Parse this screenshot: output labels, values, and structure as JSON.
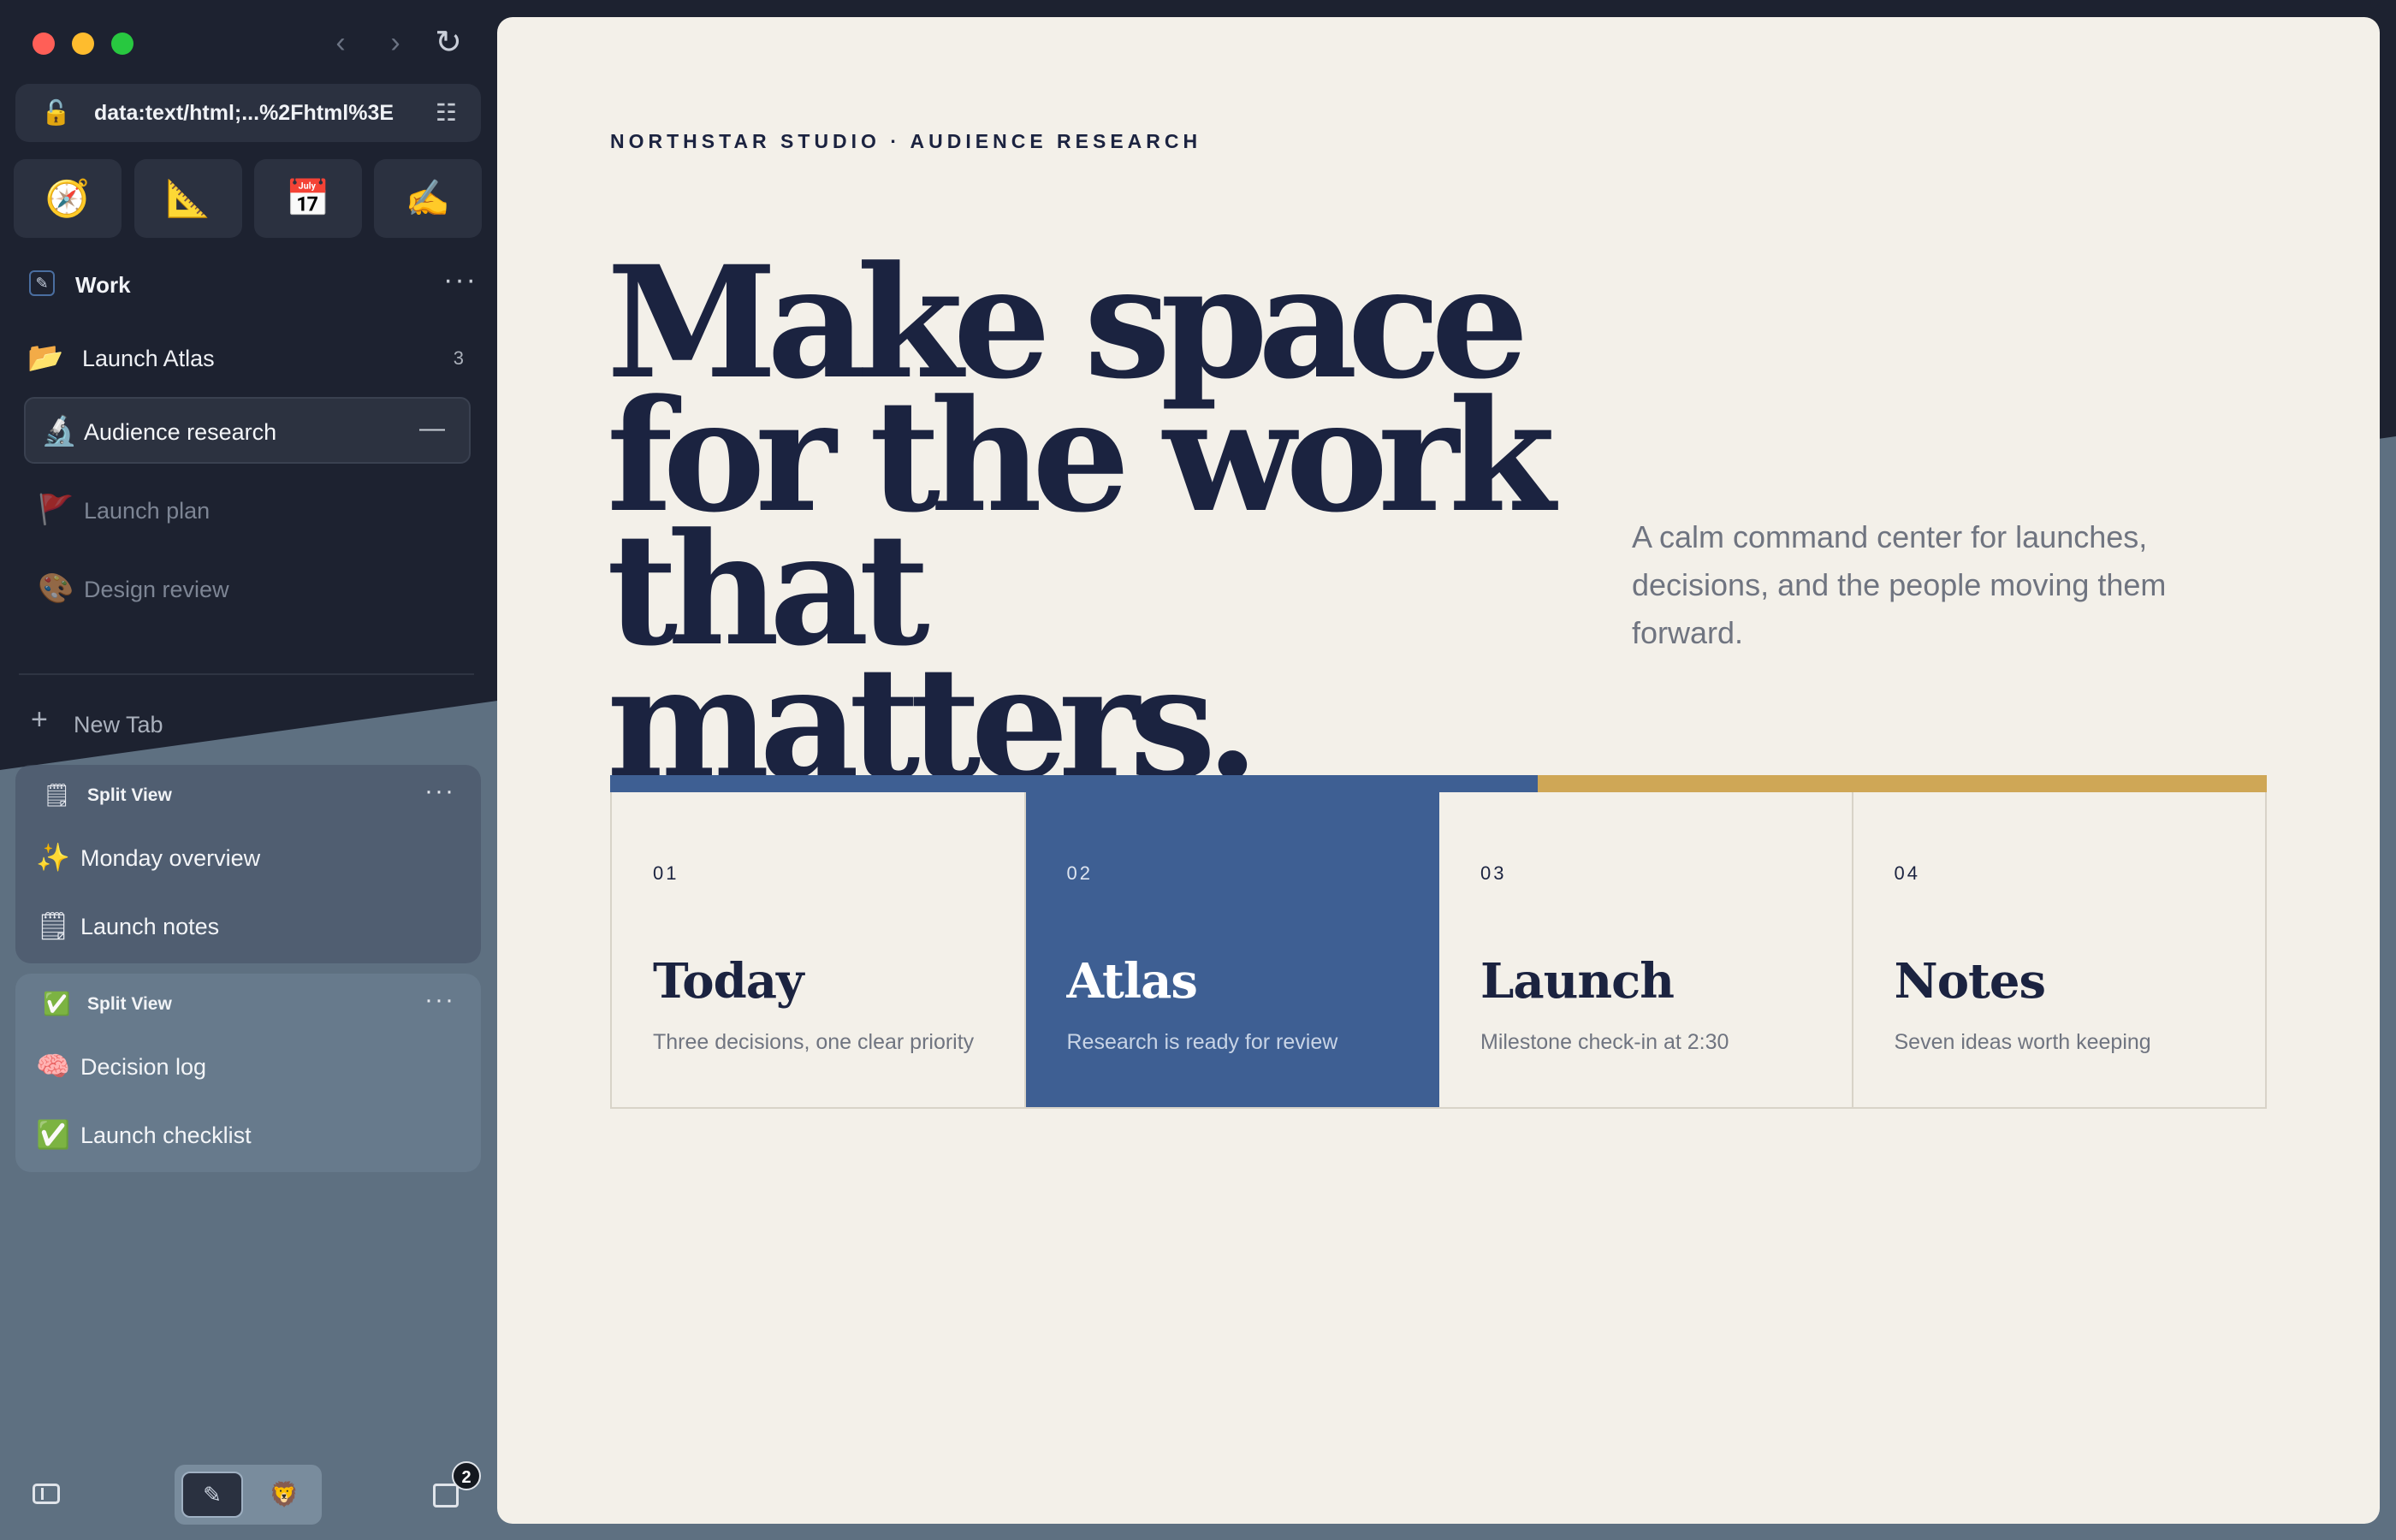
{
  "browser": {
    "url": "data:text/html;...%2Fhtml%3E",
    "pinned": [
      {
        "name": "compass-icon",
        "glyph": "🧭"
      },
      {
        "name": "triangle-ruler-icon",
        "glyph": "📐"
      },
      {
        "name": "calendar-icon",
        "glyph": "📅"
      },
      {
        "name": "writing-hand-icon",
        "glyph": "✍"
      }
    ]
  },
  "sidebar": {
    "space_name": "Work",
    "folder": {
      "label": "Launch Atlas",
      "count": "3"
    },
    "tabs": [
      {
        "label": "Audience research",
        "icon": "🔬"
      },
      {
        "label": "Launch plan",
        "icon": "🚩"
      },
      {
        "label": "Design review",
        "icon": "🎨"
      }
    ],
    "new_tab_label": "New Tab",
    "split_views": [
      {
        "label": "Split View",
        "icon": "🗒",
        "items": [
          {
            "label": "Monday overview",
            "icon": "✨"
          },
          {
            "label": "Launch notes",
            "icon": "🗒"
          }
        ]
      },
      {
        "label": "Split View",
        "icon": "✅",
        "items": [
          {
            "label": "Decision log",
            "icon": "🧠"
          },
          {
            "label": "Launch checklist",
            "icon": "✅"
          }
        ]
      }
    ],
    "archive_count": "2"
  },
  "page": {
    "eyebrow": "NORTHSTAR STUDIO · AUDIENCE RESEARCH",
    "headline": "Make space for the work that matters.",
    "subcopy": "A calm command center for launches, decisions, and the people moving them forward.",
    "cards": [
      {
        "num": "01",
        "title": "Today",
        "desc": "Three decisions, one clear priority"
      },
      {
        "num": "02",
        "title": "Atlas",
        "desc": "Research is ready for review"
      },
      {
        "num": "03",
        "title": "Launch",
        "desc": "Milestone check-in at 2:30"
      },
      {
        "num": "04",
        "title": "Notes",
        "desc": "Seven ideas worth keeping"
      }
    ],
    "colors": {
      "accent_blue": "#3e5f93",
      "accent_gold": "#cfa756",
      "ink": "#1b2340",
      "paper": "#f3f0e9"
    }
  }
}
